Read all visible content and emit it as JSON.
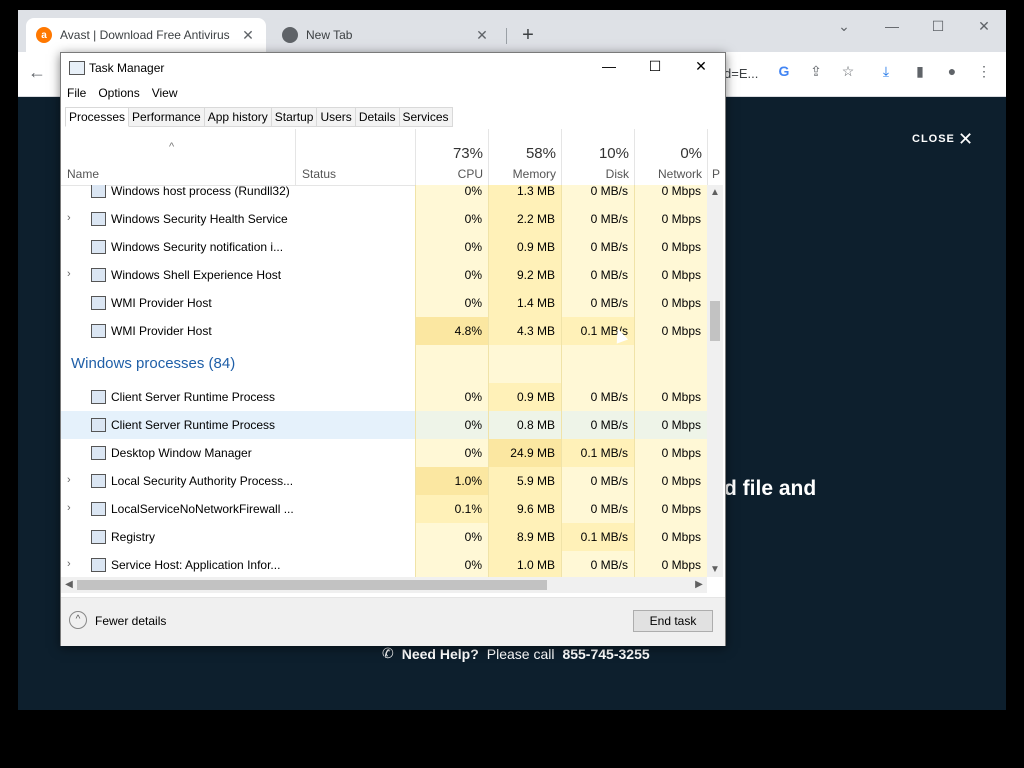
{
  "browser": {
    "tabs": [
      {
        "title": "Avast | Download Free Antivirus",
        "active": true,
        "favicon_color": "#ff7800"
      },
      {
        "title": "New Tab",
        "active": false
      }
    ],
    "omnibox_tail": "d=E...",
    "page": {
      "close_label": "CLOSE",
      "heading_fragment": "d file and",
      "help_bold": "Need Help?",
      "help_text": "Please call",
      "help_phone": "855-745-3255"
    }
  },
  "task_manager": {
    "title": "Task Manager",
    "menu": [
      "File",
      "Options",
      "View"
    ],
    "tabs": [
      "Processes",
      "Performance",
      "App history",
      "Startup",
      "Users",
      "Details",
      "Services"
    ],
    "columns": {
      "name": "Name",
      "status": "Status",
      "cpu": {
        "pct": "73%",
        "label": "CPU"
      },
      "memory": {
        "pct": "58%",
        "label": "Memory"
      },
      "disk": {
        "pct": "10%",
        "label": "Disk"
      },
      "network": {
        "pct": "0%",
        "label": "Network"
      },
      "next": "P"
    },
    "rows1": [
      {
        "name": "Windows host process (Rundll32)",
        "expand": false,
        "cpu": "0%",
        "mem": "1.3 MB",
        "disk": "0 MB/s",
        "net": "0 Mbps"
      },
      {
        "name": "Windows Security Health Service",
        "expand": true,
        "cpu": "0%",
        "mem": "2.2 MB",
        "disk": "0 MB/s",
        "net": "0 Mbps"
      },
      {
        "name": "Windows Security notification i...",
        "expand": false,
        "cpu": "0%",
        "mem": "0.9 MB",
        "disk": "0 MB/s",
        "net": "0 Mbps"
      },
      {
        "name": "Windows Shell Experience Host",
        "expand": true,
        "cpu": "0%",
        "mem": "9.2 MB",
        "disk": "0 MB/s",
        "net": "0 Mbps"
      },
      {
        "name": "WMI Provider Host",
        "expand": false,
        "cpu": "0%",
        "mem": "1.4 MB",
        "disk": "0 MB/s",
        "net": "0 Mbps"
      },
      {
        "name": "WMI Provider Host",
        "expand": false,
        "cpu": "4.8%",
        "mem": "4.3 MB",
        "disk": "0.1 MB/s",
        "net": "0 Mbps"
      }
    ],
    "group_label": "Windows processes (84)",
    "rows2": [
      {
        "name": "Client Server Runtime Process",
        "expand": false,
        "cpu": "0%",
        "mem": "0.9 MB",
        "disk": "0 MB/s",
        "net": "0 Mbps"
      },
      {
        "name": "Client Server Runtime Process",
        "expand": false,
        "cpu": "0%",
        "mem": "0.8 MB",
        "disk": "0 MB/s",
        "net": "0 Mbps",
        "selected": true
      },
      {
        "name": "Desktop Window Manager",
        "expand": false,
        "cpu": "0%",
        "mem": "24.9 MB",
        "disk": "0.1 MB/s",
        "net": "0 Mbps"
      },
      {
        "name": "Local Security Authority Process...",
        "expand": true,
        "cpu": "1.0%",
        "mem": "5.9 MB",
        "disk": "0 MB/s",
        "net": "0 Mbps"
      },
      {
        "name": "LocalServiceNoNetworkFirewall ...",
        "expand": true,
        "cpu": "0.1%",
        "mem": "9.6 MB",
        "disk": "0 MB/s",
        "net": "0 Mbps"
      },
      {
        "name": "Registry",
        "expand": false,
        "cpu": "0%",
        "mem": "8.9 MB",
        "disk": "0.1 MB/s",
        "net": "0 Mbps"
      },
      {
        "name": "Service Host: Application Infor...",
        "expand": true,
        "cpu": "0%",
        "mem": "1.0 MB",
        "disk": "0 MB/s",
        "net": "0 Mbps"
      }
    ],
    "footer": {
      "fewer_details": "Fewer details",
      "end_task": "End task"
    },
    "colors": {
      "heat_light": "#fff8d6",
      "heat_mid": "#fff1b8",
      "heat_strong": "#fbe7a1",
      "selected": "#e5f1fb",
      "group_text": "#1f5fa8"
    }
  }
}
